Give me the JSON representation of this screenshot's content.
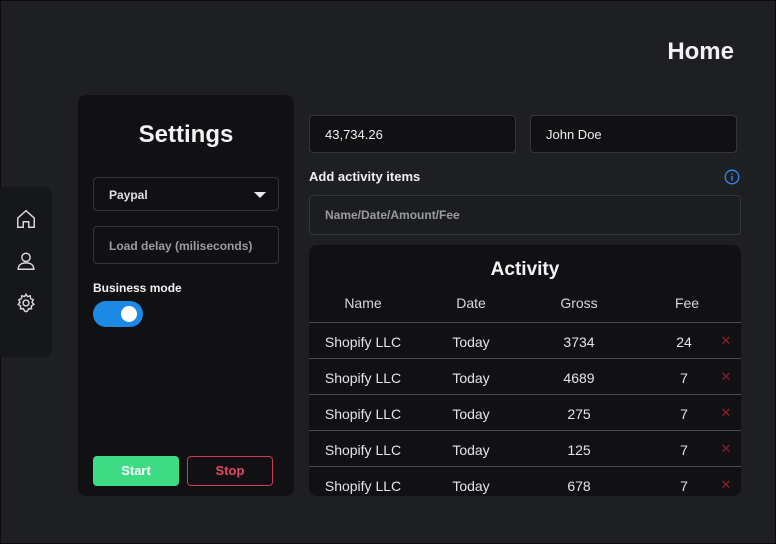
{
  "header": {
    "title": "Home"
  },
  "nav": {
    "items": [
      {
        "icon": "home-icon"
      },
      {
        "icon": "user-icon"
      },
      {
        "icon": "gear-icon"
      }
    ]
  },
  "settings": {
    "title": "Settings",
    "payment_method": "Paypal",
    "delay_placeholder": "Load delay (miliseconds)",
    "business_mode_label": "Business mode",
    "business_mode_on": true,
    "start_label": "Start",
    "stop_label": "Stop"
  },
  "form": {
    "amount_value": "43,734.26",
    "name_value": "John Doe",
    "add_items_label": "Add activity items",
    "activity_placeholder": "Name/Date/Amount/Fee"
  },
  "activity": {
    "title": "Activity",
    "columns": [
      "Name",
      "Date",
      "Gross",
      "Fee"
    ],
    "rows": [
      {
        "name": "Shopify LLC",
        "date": "Today",
        "gross": "3734",
        "fee": "24"
      },
      {
        "name": "Shopify LLC",
        "date": "Today",
        "gross": "4689",
        "fee": "7"
      },
      {
        "name": "Shopify LLC",
        "date": "Today",
        "gross": "275",
        "fee": "7"
      },
      {
        "name": "Shopify LLC",
        "date": "Today",
        "gross": "125",
        "fee": "7"
      },
      {
        "name": "Shopify LLC",
        "date": "Today",
        "gross": "678",
        "fee": "7"
      }
    ]
  },
  "colors": {
    "accent_blue": "#1e88e5",
    "start_green": "#3ddc84",
    "stop_red": "#e04a66"
  }
}
